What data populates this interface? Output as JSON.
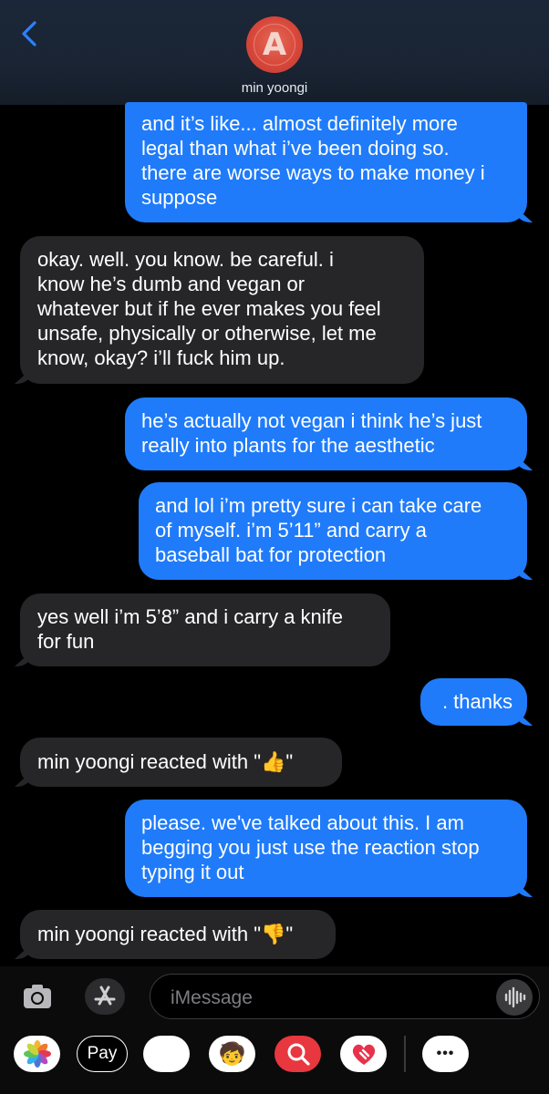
{
  "header": {
    "contact_name": "min yoongi",
    "back_icon": "chevron-left-icon",
    "avatar_letter": "A"
  },
  "messages": [
    {
      "type": "sent",
      "lines": [
        "and it’s like... almost definitely more",
        "legal than what i’ve been doing so.",
        "there are worse ways to make money i",
        "suppose"
      ]
    },
    {
      "type": "received",
      "lines": [
        "okay. well. you know. be careful. i",
        "know he’s dumb and vegan or",
        "whatever but if he ever makes you feel",
        "unsafe, physically or otherwise, let me",
        "know, okay? i’ll fuck him up."
      ]
    },
    {
      "type": "sent",
      "lines": [
        "he’s actually not vegan i think he’s just",
        "really into plants for the aesthetic"
      ]
    },
    {
      "type": "sent",
      "lines": [
        "and lol i’m pretty sure i can take care",
        "of myself. i’m 5’11” and carry a",
        "baseball bat for protection"
      ]
    },
    {
      "type": "received",
      "lines": [
        "yes well i’m 5’8” and i carry a knife",
        "for fun"
      ]
    },
    {
      "type": "sent",
      "lines": [
        ". thanks"
      ]
    },
    {
      "type": "received",
      "lines": [
        "min yoongi reacted with \"👍\""
      ]
    },
    {
      "type": "sent",
      "lines": [
        "please. we've talked about this. I am",
        "begging you just use the reaction stop",
        "typing it out"
      ]
    },
    {
      "type": "received",
      "lines": [
        "min yoongi reacted with \"👎\""
      ]
    }
  ],
  "composer": {
    "placeholder": "iMessage",
    "camera_icon": "camera-icon",
    "appstore_icon": "app-store-icon",
    "audio_icon": "audio-waveform-icon"
  },
  "app_drawer": [
    {
      "name": "photos-app-icon",
      "label": "🌸"
    },
    {
      "name": "apple-pay-app-icon",
      "label": "Pay"
    },
    {
      "name": "animoji-monkey-icon",
      "label": "🐵"
    },
    {
      "name": "memoji-icon",
      "label": "🧒"
    },
    {
      "name": "image-search-app-icon",
      "label": "🔍"
    },
    {
      "name": "digital-touch-icon",
      "label": "💗"
    },
    {
      "name": "more-apps-icon",
      "label": "•••"
    }
  ],
  "colors": {
    "sent_bubble": "#1f7bfa",
    "received_bubble": "#262628",
    "accent": "#2f80ff"
  }
}
